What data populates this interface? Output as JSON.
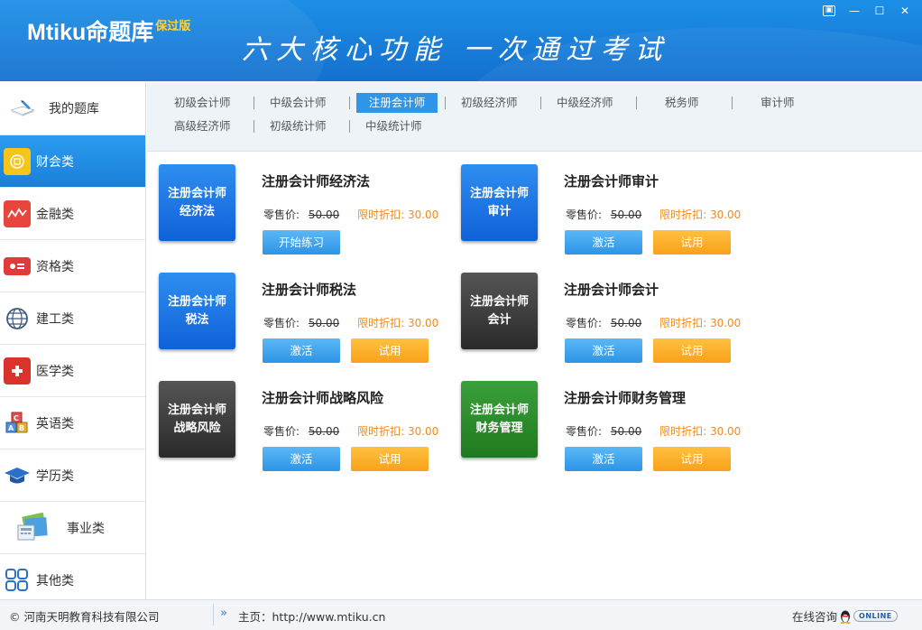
{
  "header": {
    "app_name": "Mtiku命题库",
    "edition": "保过版",
    "slogan": "六大核心功能 一次通过考试",
    "window_controls": [
      "▣",
      "—",
      "☐",
      "✕"
    ]
  },
  "sidebar": {
    "items": [
      {
        "label": "我的题库",
        "icon": "book-pen-icon"
      },
      {
        "label": "财会类",
        "icon": "calculator-icon",
        "active": true
      },
      {
        "label": "金融类",
        "icon": "finance-chart-icon"
      },
      {
        "label": "资格类",
        "icon": "id-card-icon"
      },
      {
        "label": "建工类",
        "icon": "globe-icon"
      },
      {
        "label": "医学类",
        "icon": "medical-kit-icon"
      },
      {
        "label": "英语类",
        "icon": "abc-blocks-icon"
      },
      {
        "label": "学历类",
        "icon": "graduation-cap-icon"
      },
      {
        "label": "事业类",
        "icon": "documents-icon"
      },
      {
        "label": "其他类",
        "icon": "grid-icon"
      }
    ]
  },
  "tabs": {
    "row1": [
      "初级会计师",
      "中级会计师",
      "注册会计师",
      "初级经济师",
      "中级经济师",
      "税务师",
      "审计师"
    ],
    "row2": [
      "高级经济师",
      "初级统计师",
      "中级统计师"
    ],
    "active": "注册会计师"
  },
  "cards": [
    {
      "thumb": "注册会计师\n经济法",
      "title": "注册会计师经济法",
      "retail_label": "零售价:",
      "retail": "50.00",
      "discount_label": "限时折扣:",
      "discount": "30.00",
      "btn1": "开始练习",
      "btn2": ""
    },
    {
      "thumb": "注册会计师\n审计",
      "title": "注册会计师审计",
      "retail_label": "零售价:",
      "retail": "50.00",
      "discount_label": "限时折扣:",
      "discount": "30.00",
      "btn1": "激活",
      "btn2": "试用"
    },
    {
      "thumb": "注册会计师\n税法",
      "title": "注册会计师税法",
      "retail_label": "零售价:",
      "retail": "50.00",
      "discount_label": "限时折扣:",
      "discount": "30.00",
      "btn1": "激活",
      "btn2": "试用"
    },
    {
      "thumb": "注册会计师\n会计",
      "title": "注册会计师会计",
      "retail_label": "零售价:",
      "retail": "50.00",
      "discount_label": "限时折扣:",
      "discount": "30.00",
      "btn1": "激活",
      "btn2": "试用"
    },
    {
      "thumb": "注册会计师\n战略风险",
      "title": "注册会计师战略风险",
      "retail_label": "零售价:",
      "retail": "50.00",
      "discount_label": "限时折扣:",
      "discount": "30.00",
      "btn1": "激活",
      "btn2": "试用"
    },
    {
      "thumb": "注册会计师\n财务管理",
      "title": "注册会计师财务管理",
      "retail_label": "零售价:",
      "retail": "50.00",
      "discount_label": "限时折扣:",
      "discount": "30.00",
      "btn1": "激活",
      "btn2": "试用"
    }
  ],
  "footer": {
    "copyright": "© 河南天明教育科技有限公司",
    "home_label": "主页：http://www.mtiku.cn",
    "online_label": "在线咨询",
    "online_badge": "ONLINE"
  },
  "colors": {
    "header": "#1c8fe6",
    "active_tab": "#2e95e8",
    "discount": "#f08a1a",
    "button_blue": "#2d94e6",
    "button_orange": "#f9a11a"
  }
}
